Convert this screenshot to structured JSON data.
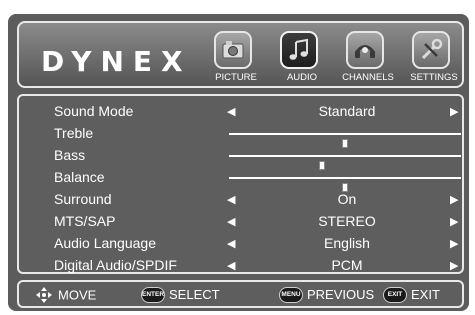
{
  "brand": "DYNEX",
  "tabs": [
    {
      "label": "PICTURE",
      "icon": "picture-icon",
      "active": false
    },
    {
      "label": "AUDIO",
      "icon": "audio-icon",
      "active": true
    },
    {
      "label": "CHANNELS",
      "icon": "channels-icon",
      "active": false
    },
    {
      "label": "SETTINGS",
      "icon": "settings-icon",
      "active": false
    }
  ],
  "menu": {
    "sound_mode": {
      "label": "Sound Mode",
      "value": "Standard"
    },
    "treble": {
      "label": "Treble",
      "value": 50,
      "value_text": "50",
      "min": 0,
      "max": 100
    },
    "bass": {
      "label": "Bass",
      "value": 40,
      "value_text": "40",
      "min": 0,
      "max": 100
    },
    "balance": {
      "label": "Balance",
      "value": 0,
      "value_text": "0",
      "min": -50,
      "max": 50
    },
    "surround": {
      "label": "Surround",
      "value": "On"
    },
    "mts_sap": {
      "label": "MTS/SAP",
      "value": "STEREO"
    },
    "audio_language": {
      "label": "Audio Language",
      "value": "English"
    },
    "digital_audio": {
      "label": "Digital Audio/SPDIF",
      "value": "PCM"
    }
  },
  "footer": {
    "move": {
      "icon": "dpad-icon",
      "label": "MOVE"
    },
    "select": {
      "badge": "ENTER",
      "label": "SELECT"
    },
    "previous": {
      "badge": "MENU",
      "label": "PREVIOUS"
    },
    "exit": {
      "badge": "EXIT",
      "label": "EXIT"
    }
  },
  "colors": {
    "panel": "#5e5e5e",
    "frame": "#e8e8e8",
    "text": "#ffffff",
    "active_tab": "#1e1e1e"
  }
}
